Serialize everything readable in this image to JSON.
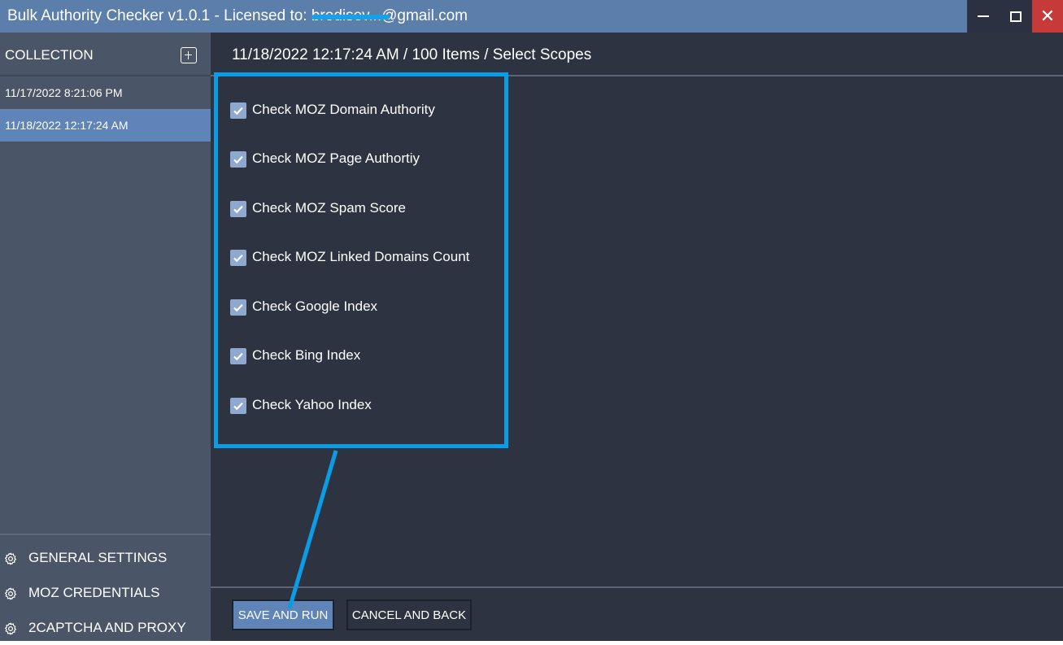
{
  "window": {
    "title_prefix": "Bulk Authority Checker v1.0.1 - Licensed to: ",
    "email_visible": "brodisev...@gmail.com",
    "controls": [
      "minimize-icon",
      "maximize-icon",
      "close-icon"
    ],
    "close_glyph": "✕"
  },
  "sidebar": {
    "header_label": "COLLECTION",
    "add_icon": "plus-square-icon",
    "collections": [
      {
        "label": "11/17/2022 8:21:06 PM",
        "selected": false
      },
      {
        "label": "11/18/2022 12:17:24 AM",
        "selected": true
      }
    ],
    "footer_items": [
      {
        "label": "GENERAL SETTINGS",
        "icon": "gear-icon"
      },
      {
        "label": "MOZ CREDENTIALS",
        "icon": "gear-icon"
      },
      {
        "label": "2CAPTCHA AND PROXY",
        "icon": "gear-icon"
      }
    ]
  },
  "main": {
    "breadcrumb": "11/18/2022 12:17:24 AM / 100 Items / Select Scopes",
    "scopes": [
      {
        "label": "Check MOZ Domain Authority",
        "checked": true
      },
      {
        "label": "Check MOZ Page Authortiy",
        "checked": true
      },
      {
        "label": "Check MOZ Spam Score",
        "checked": true
      },
      {
        "label": "Check MOZ Linked Domains Count",
        "checked": true
      },
      {
        "label": "Check Google Index",
        "checked": true
      },
      {
        "label": "Check Bing Index",
        "checked": true
      },
      {
        "label": "Check Yahoo Index",
        "checked": true
      }
    ],
    "buttons": {
      "save_run": "SAVE AND RUN",
      "cancel_back": "CANCEL AND BACK"
    }
  },
  "colors": {
    "titlebar": "#5b7eaa",
    "sidebar": "#4a5568",
    "sidebar_selected": "#5f84b8",
    "main_bg": "#2d3340",
    "annotation": "#0a9de6",
    "close_button": "#c73a3a"
  }
}
